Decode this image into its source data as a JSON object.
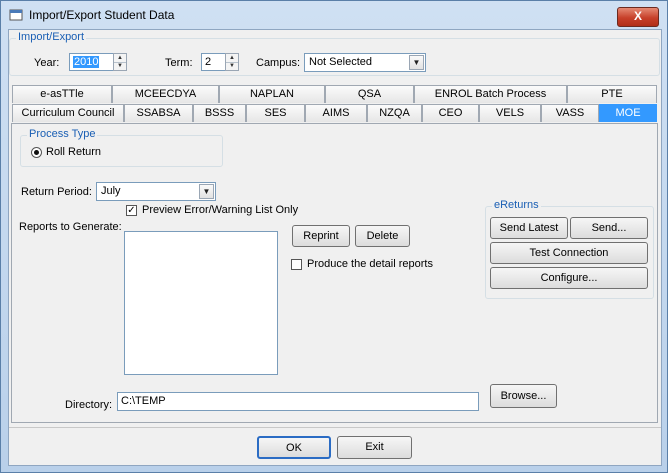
{
  "window": {
    "title": "Import/Export Student Data",
    "close_label": "X"
  },
  "import_export": {
    "legend": "Import/Export",
    "year_label": "Year:",
    "year_value": "2010",
    "term_label": "Term:",
    "term_value": "2",
    "campus_label": "Campus:",
    "campus_value": "Not Selected"
  },
  "tabs_row1": [
    "e-asTTle",
    "MCEECDYA",
    "NAPLAN",
    "QSA",
    "ENROL Batch Process",
    "PTE"
  ],
  "tabs_row2": [
    "Curriculum Council",
    "SSABSA",
    "BSSS",
    "SES",
    "AIMS",
    "NZQA",
    "CEO",
    "VELS",
    "VASS",
    "MOE"
  ],
  "active_tab": "MOE",
  "process_type": {
    "legend": "Process Type",
    "option": "Roll Return",
    "selected": true
  },
  "return_period": {
    "label": "Return Period:",
    "value": "July"
  },
  "reports": {
    "label": "Reports to Generate:",
    "preview_label": "Preview Error/Warning List Only",
    "preview_checked": true
  },
  "reprint_label": "Reprint",
  "delete_label": "Delete",
  "detail_reports": {
    "label": "Produce the detail reports",
    "checked": false
  },
  "ereturns": {
    "legend": "eReturns",
    "send_latest": "Send Latest",
    "send": "Send...",
    "test_connection": "Test Connection",
    "configure": "Configure..."
  },
  "directory": {
    "label": "Directory:",
    "value": "C:\\TEMP"
  },
  "browse_label": "Browse...",
  "ok_label": "OK",
  "exit_label": "Exit",
  "colors": {
    "accent": "#3399ff",
    "group_legend": "#1a5fb4",
    "close_button": "#c7402a"
  }
}
